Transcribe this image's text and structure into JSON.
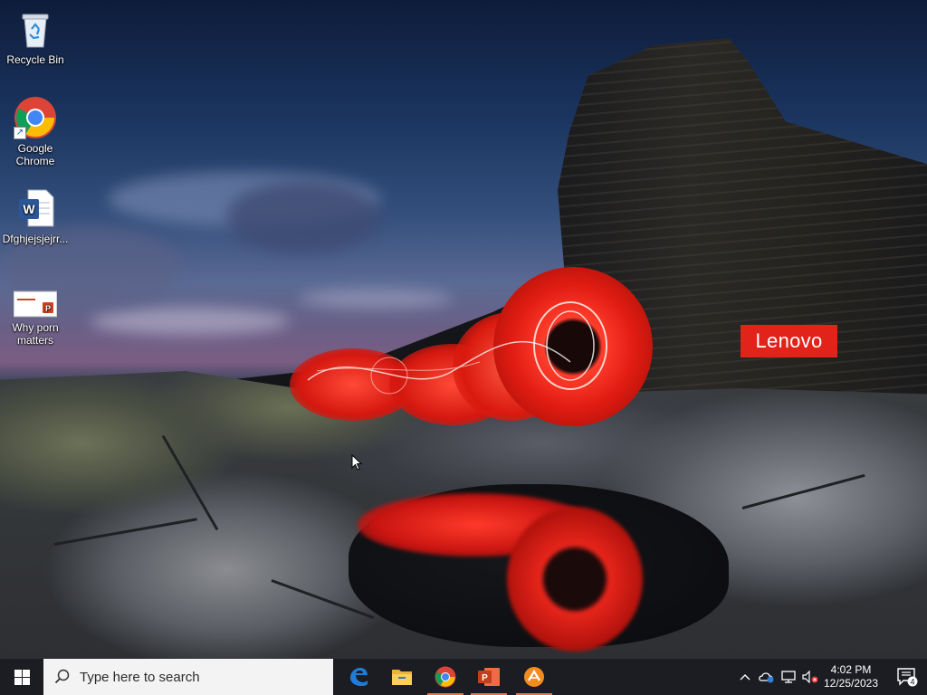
{
  "desktop": {
    "icons": [
      {
        "label": "Recycle Bin",
        "icon": "recycle-bin-icon"
      },
      {
        "label": "Google Chrome",
        "icon": "chrome-icon",
        "shortcut": true
      },
      {
        "label": "Dfghjejsjejrr...",
        "icon": "word-document-icon"
      },
      {
        "label": "Why porn matters",
        "icon": "powerpoint-presentation-icon"
      }
    ],
    "wallpaper_brand": "Lenovo"
  },
  "taskbar": {
    "search_placeholder": "Type here to search",
    "pinned_apps": [
      {
        "name": "Microsoft Edge",
        "icon": "edge-icon",
        "active": false
      },
      {
        "name": "File Explorer",
        "icon": "file-explorer-icon",
        "active": false
      },
      {
        "name": "Google Chrome",
        "icon": "chrome-icon",
        "active": true
      },
      {
        "name": "PowerPoint",
        "icon": "powerpoint-icon",
        "active": true
      },
      {
        "name": "Sublime-style app",
        "icon": "orange-app-icon",
        "active": true
      }
    ],
    "tray": {
      "time": "4:02 PM",
      "date": "12/25/2023",
      "notification_count": "4"
    }
  },
  "colors": {
    "taskbar_bg": "#1c1d22",
    "active_indicator": "#e8724a",
    "lenovo_red": "#e2231a"
  }
}
